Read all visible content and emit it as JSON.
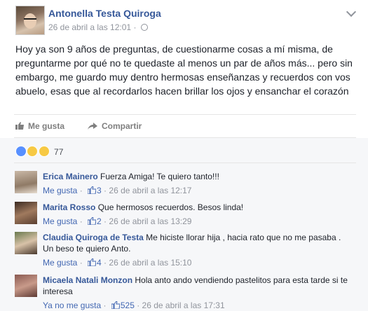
{
  "post": {
    "author": "Antonella Testa Quiroga",
    "timestamp": "26 de abril a las 12:01",
    "separator": "·",
    "text": "Hoy ya son 9 años de preguntas, de cuestionarme cosas a mí misma, de preguntarme por qué no te quedaste al menos un par de años más... pero sin embargo, me guardo muy dentro hermosas enseñanzas y recuerdos con vos abuelo, esas que al recordarlos hacen brillar los ojos y ensanchar el corazón",
    "actions": {
      "like": "Me gusta",
      "share": "Compartir"
    },
    "reaction_count": "77"
  },
  "comments": [
    {
      "name": "Erica Mainero",
      "text": "Fuerza Amiga! Te quiero tanto!!!",
      "like_label": "Me gusta",
      "likes": "3",
      "time": "26 de abril a las 12:17"
    },
    {
      "name": "Marita Rosso",
      "text": "Que hermosos recuerdos. Besos linda!",
      "like_label": "Me gusta",
      "likes": "2",
      "time": "26 de abril a las 13:29"
    },
    {
      "name": "Claudia Quiroga de Testa",
      "text": "Me hiciste llorar hija , hacia rato que no me pasaba . Un beso te quiero Anto.",
      "like_label": "Me gusta",
      "likes": "4",
      "time": "26 de abril a las 15:10"
    },
    {
      "name": "Micaela Natali Monzon",
      "text": "Hola anto ando vendiendo pastelitos para esta tarde si te interesa",
      "like_label": "Ya no me gusta",
      "likes": "525",
      "time": "26 de abril a las 17:31"
    }
  ],
  "colors": {
    "link": "#365899",
    "meta": "#90949c",
    "like_blue": "#4267b2"
  },
  "icons": [
    "globe-icon",
    "chevron-down-icon",
    "like-thumb-icon",
    "share-icon",
    "like-reaction-icon",
    "sad-reaction-icon",
    "wow-reaction-icon"
  ]
}
